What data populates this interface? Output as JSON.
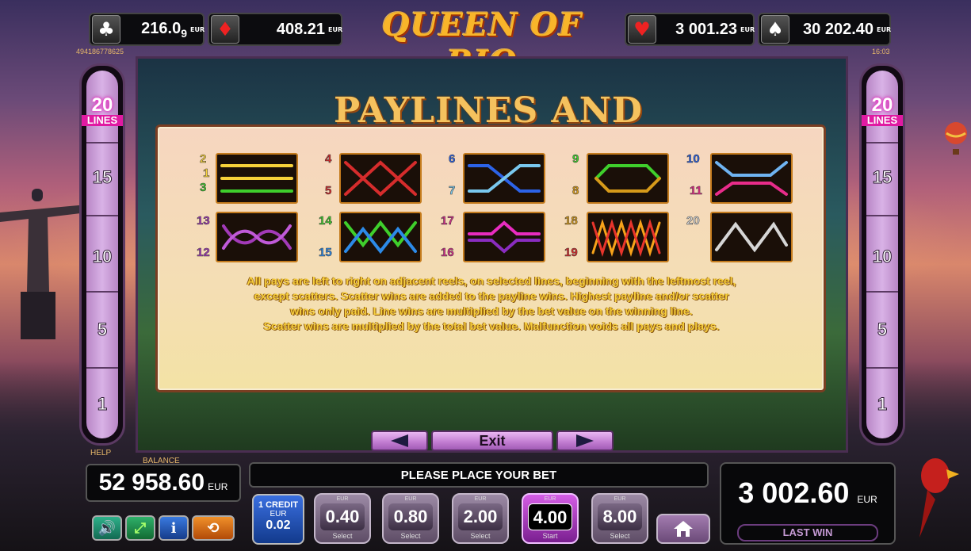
{
  "jackpots": [
    {
      "suit_icon": "club-icon",
      "suit_glyph": "♣",
      "value": "216.0",
      "sub": "9",
      "currency": "EUR"
    },
    {
      "suit_icon": "diamond-icon",
      "suit_glyph": "♦",
      "value": "408.21",
      "currency": "EUR"
    },
    {
      "suit_icon": "heart-icon",
      "suit_glyph": "♥",
      "value": "3 001.23",
      "currency": "EUR"
    },
    {
      "suit_icon": "spade-icon",
      "suit_glyph": "♠",
      "value": "30 202.40",
      "currency": "EUR"
    }
  ],
  "game_title": "QUEEN OF RIO",
  "session_id": "494186778625",
  "clock": "16:03",
  "lines": {
    "count": "20",
    "label": "LINES",
    "markers": [
      "15",
      "10",
      "5",
      "1"
    ]
  },
  "panel": {
    "title": "PAYLINES AND RULES",
    "rules_lines": [
      "All pays are left to right on adjacent reels, on selected lines, beginning with the leftmost reel,",
      "except scatters. Scatter wins are added to the payline wins. Highest payline and/or scatter",
      "wins only paid. Line wins are multiplied by the bet value on the winning line.",
      "Scatter wins are multiplied by the total bet value. Malfunction voids all pays and plays."
    ],
    "payline_numbers": {
      "g1": [
        "2",
        "1",
        "3"
      ],
      "g2": [
        "4",
        "5"
      ],
      "g3": [
        "6",
        "7"
      ],
      "g4": [
        "9",
        "8"
      ],
      "g5": [
        "10",
        "11"
      ],
      "g6": [
        "13",
        "12"
      ],
      "g7": [
        "14",
        "15"
      ],
      "g8": [
        "17",
        "16"
      ],
      "g9": [
        "18",
        "19"
      ],
      "g10": [
        "20"
      ]
    }
  },
  "nav": {
    "exit_label": "Exit"
  },
  "bottom": {
    "help_label": "HELP",
    "balance_label": "BALANCE",
    "balance_value": "52 958.60",
    "balance_currency": "EUR",
    "message": "PLEASE PLACE YOUR BET",
    "last_win_value": "3 002.60",
    "last_win_currency": "EUR",
    "last_win_label": "LAST WIN",
    "credit": {
      "title": "1 CREDIT",
      "currency": "EUR",
      "value": "0.02"
    },
    "bets": [
      {
        "currency": "EUR",
        "value": "0.40",
        "action": "Select",
        "active": false
      },
      {
        "currency": "EUR",
        "value": "0.80",
        "action": "Select",
        "active": false
      },
      {
        "currency": "EUR",
        "value": "2.00",
        "action": "Select",
        "active": false
      },
      {
        "currency": "EUR",
        "value": "4.00",
        "action": "Start",
        "active": true
      },
      {
        "currency": "EUR",
        "value": "8.00",
        "action": "Select",
        "active": false
      }
    ]
  },
  "colors": {
    "accent_gold": "#f5c25e",
    "rules_text": "#f7cf3d",
    "line_bar": "#d9b2e6",
    "active_bet": "#d55ee6"
  }
}
